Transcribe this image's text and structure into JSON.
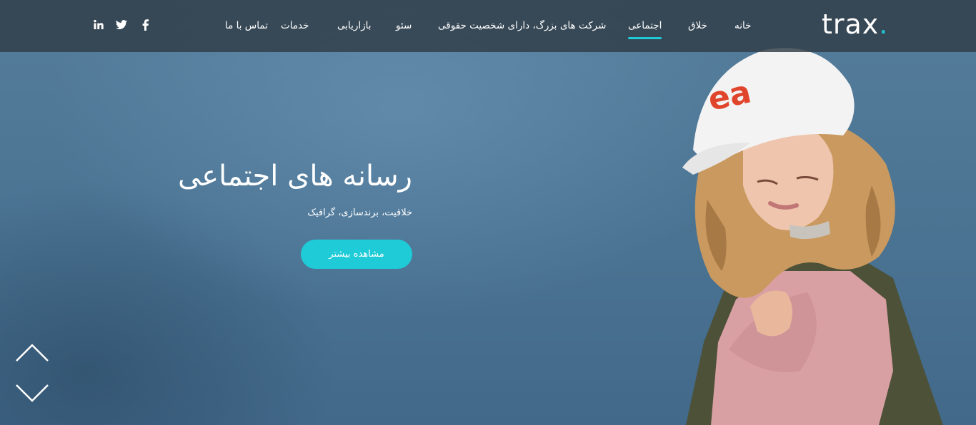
{
  "header": {
    "logo": {
      "text": "trax",
      "dot": "."
    },
    "nav": [
      {
        "label": "خانه"
      },
      {
        "label": "خلاق"
      },
      {
        "label": "اجتماعی",
        "active": true
      },
      {
        "label": "شرکت های بزرگ، دارای شخصیت حقوقی"
      },
      {
        "label": "سئو"
      },
      {
        "label": "بازاریابی"
      },
      {
        "label": "خدمات"
      },
      {
        "label": "تماس با ما"
      }
    ],
    "social": [
      {
        "icon": "facebook-icon"
      },
      {
        "icon": "twitter-icon"
      },
      {
        "icon": "linkedin-icon"
      }
    ]
  },
  "hero": {
    "title": "رسانه های اجتماعی",
    "subtitle": "خلاقیت، برندسازی، گرافیک",
    "cta_label": "مشاهده بیشتر"
  },
  "slider": {
    "prev_icon": "chevron-up-icon",
    "next_icon": "chevron-down-icon"
  },
  "colors": {
    "accent": "#1fc9d6",
    "header_bg": "#303c46",
    "hero_bg": "#4a7494",
    "text": "#ffffff"
  }
}
